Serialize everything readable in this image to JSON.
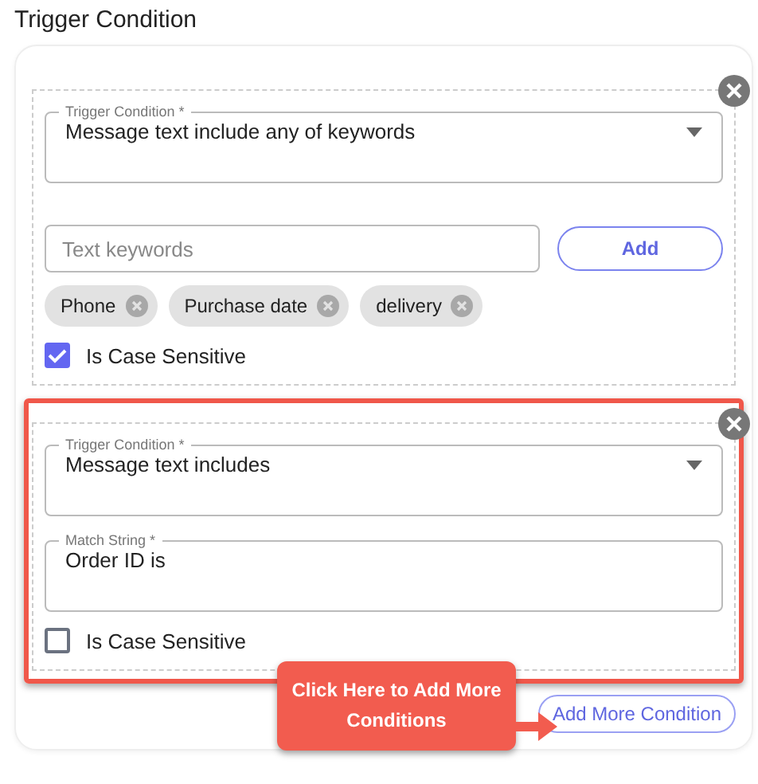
{
  "title": "Trigger Condition",
  "conditions": [
    {
      "kind": "keywords",
      "highlighted": false,
      "select": {
        "label": "Trigger Condition *",
        "value": "Message text include any of keywords"
      },
      "keyword_field": {
        "placeholder": "Text keywords"
      },
      "add_button": "Add",
      "chips": [
        "Phone",
        "Purchase date",
        "delivery"
      ],
      "case_sensitive": {
        "label": "Is Case Sensitive",
        "checked": true
      }
    },
    {
      "kind": "match",
      "highlighted": true,
      "select": {
        "label": "Trigger Condition *",
        "value": "Message text includes"
      },
      "match_field": {
        "label": "Match String *",
        "value": "Order ID is"
      },
      "case_sensitive": {
        "label": "Is Case Sensitive",
        "checked": false
      }
    }
  ],
  "add_more_button": "Add More Condition",
  "callout": "Click Here to Add More Conditions"
}
